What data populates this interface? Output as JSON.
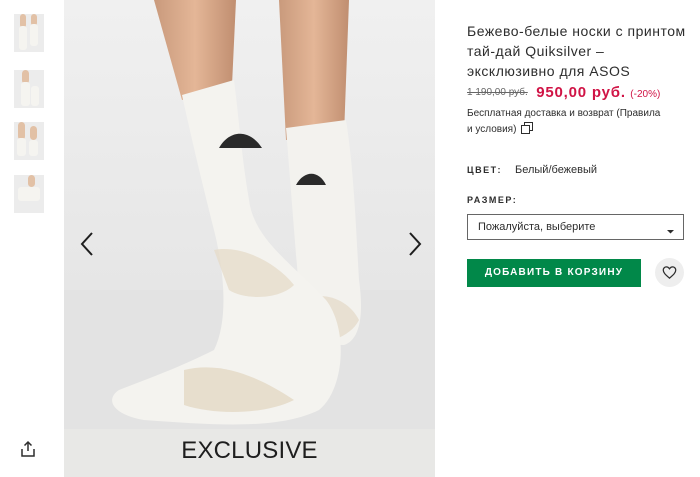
{
  "gallery": {
    "thumbnails": [
      {
        "label": "thumbnail-1"
      },
      {
        "label": "thumbnail-2"
      },
      {
        "label": "thumbnail-3"
      },
      {
        "label": "thumbnail-4"
      }
    ],
    "overlay_text": "EXCLUSIVE",
    "prev_icon": "chevron-left-icon",
    "next_icon": "chevron-right-icon",
    "share_icon": "share-icon"
  },
  "product": {
    "title": "Бежево-белые носки с принтом тай-дай Quiksilver – эксклюзивно для ASOS",
    "old_price": "1 190,00 руб.",
    "new_price": "950,00 руб.",
    "discount": "(-20%)",
    "delivery_text": "Бесплатная доставка и возврат (Правила и условия)",
    "color_label": "ЦВЕТ:",
    "color_value": "Белый/бежевый",
    "size_label": "РАЗМЕР:",
    "size_placeholder": "Пожалуйста, выберите",
    "add_to_cart": "ДОБАВИТЬ В КОРЗИНУ",
    "wishlist_icon": "heart-icon"
  },
  "colors": {
    "price_red": "#d01345",
    "button_green": "#018849",
    "text": "#2d2d2d"
  }
}
